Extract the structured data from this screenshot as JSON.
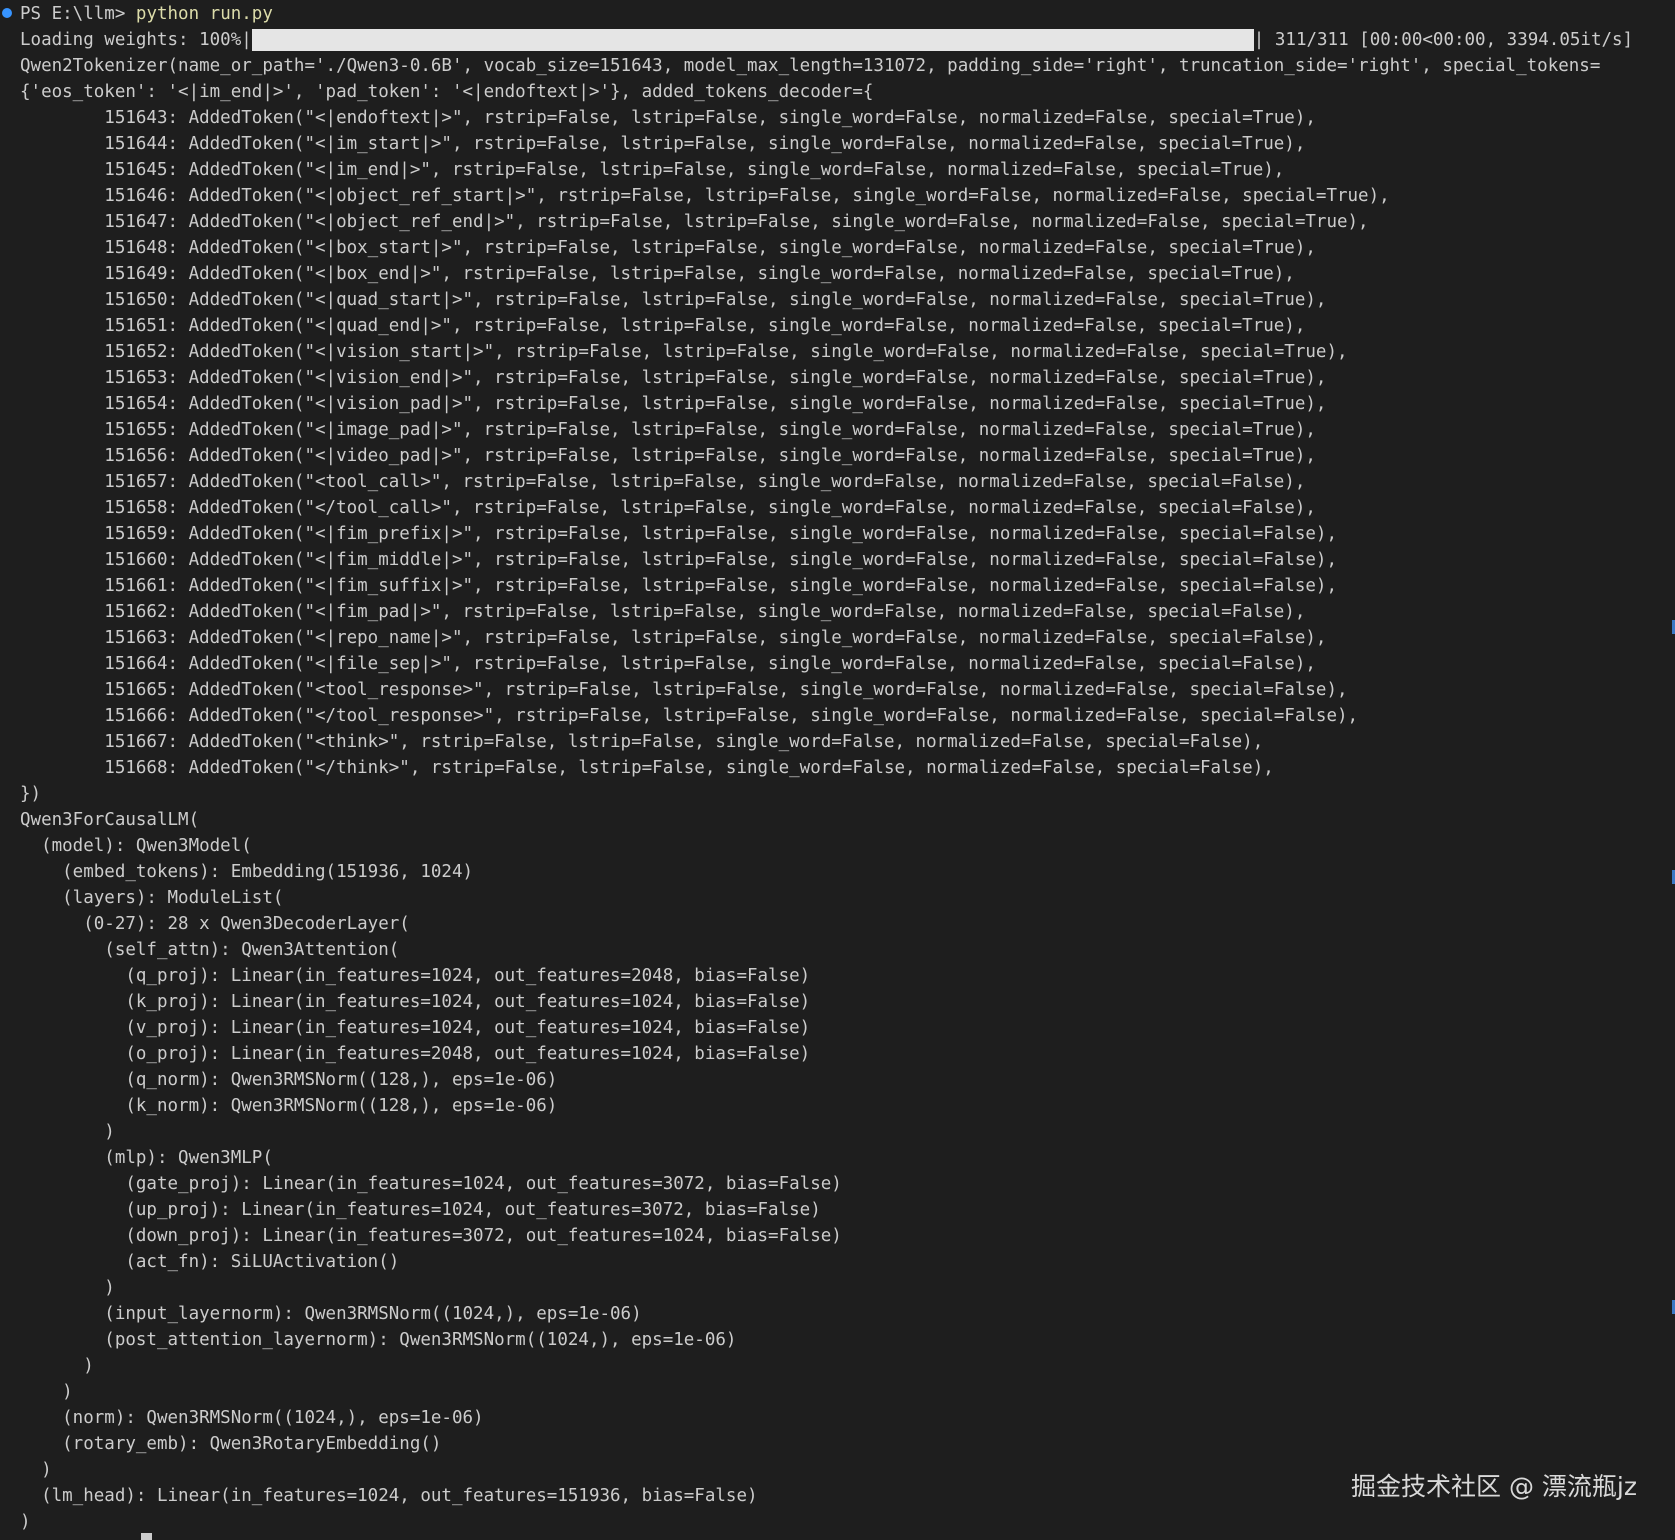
{
  "prompt": {
    "text": "PS E:\\llm> ",
    "command": "python run.py"
  },
  "progress": {
    "label": "Loading weights: 100%|",
    "fraction": 1.0,
    "suffix": "| 311/311 [00:00<00:00, 3394.05it/s]"
  },
  "lines": [
    "Qwen2Tokenizer(name_or_path='./Qwen3-0.6B', vocab_size=151643, model_max_length=131072, padding_side='right', truncation_side='right', special_tokens=",
    "{'eos_token': '<|im_end|>', 'pad_token': '<|endoftext|>'}, added_tokens_decoder={",
    "        151643: AddedToken(\"<|endoftext|>\", rstrip=False, lstrip=False, single_word=False, normalized=False, special=True),",
    "        151644: AddedToken(\"<|im_start|>\", rstrip=False, lstrip=False, single_word=False, normalized=False, special=True),",
    "        151645: AddedToken(\"<|im_end|>\", rstrip=False, lstrip=False, single_word=False, normalized=False, special=True),",
    "        151646: AddedToken(\"<|object_ref_start|>\", rstrip=False, lstrip=False, single_word=False, normalized=False, special=True),",
    "        151647: AddedToken(\"<|object_ref_end|>\", rstrip=False, lstrip=False, single_word=False, normalized=False, special=True),",
    "        151648: AddedToken(\"<|box_start|>\", rstrip=False, lstrip=False, single_word=False, normalized=False, special=True),",
    "        151649: AddedToken(\"<|box_end|>\", rstrip=False, lstrip=False, single_word=False, normalized=False, special=True),",
    "        151650: AddedToken(\"<|quad_start|>\", rstrip=False, lstrip=False, single_word=False, normalized=False, special=True),",
    "        151651: AddedToken(\"<|quad_end|>\", rstrip=False, lstrip=False, single_word=False, normalized=False, special=True),",
    "        151652: AddedToken(\"<|vision_start|>\", rstrip=False, lstrip=False, single_word=False, normalized=False, special=True),",
    "        151653: AddedToken(\"<|vision_end|>\", rstrip=False, lstrip=False, single_word=False, normalized=False, special=True),",
    "        151654: AddedToken(\"<|vision_pad|>\", rstrip=False, lstrip=False, single_word=False, normalized=False, special=True),",
    "        151655: AddedToken(\"<|image_pad|>\", rstrip=False, lstrip=False, single_word=False, normalized=False, special=True),",
    "        151656: AddedToken(\"<|video_pad|>\", rstrip=False, lstrip=False, single_word=False, normalized=False, special=True),",
    "        151657: AddedToken(\"<tool_call>\", rstrip=False, lstrip=False, single_word=False, normalized=False, special=False),",
    "        151658: AddedToken(\"</tool_call>\", rstrip=False, lstrip=False, single_word=False, normalized=False, special=False),",
    "        151659: AddedToken(\"<|fim_prefix|>\", rstrip=False, lstrip=False, single_word=False, normalized=False, special=False),",
    "        151660: AddedToken(\"<|fim_middle|>\", rstrip=False, lstrip=False, single_word=False, normalized=False, special=False),",
    "        151661: AddedToken(\"<|fim_suffix|>\", rstrip=False, lstrip=False, single_word=False, normalized=False, special=False),",
    "        151662: AddedToken(\"<|fim_pad|>\", rstrip=False, lstrip=False, single_word=False, normalized=False, special=False),",
    "        151663: AddedToken(\"<|repo_name|>\", rstrip=False, lstrip=False, single_word=False, normalized=False, special=False),",
    "        151664: AddedToken(\"<|file_sep|>\", rstrip=False, lstrip=False, single_word=False, normalized=False, special=False),",
    "        151665: AddedToken(\"<tool_response>\", rstrip=False, lstrip=False, single_word=False, normalized=False, special=False),",
    "        151666: AddedToken(\"</tool_response>\", rstrip=False, lstrip=False, single_word=False, normalized=False, special=False),",
    "        151667: AddedToken(\"<think>\", rstrip=False, lstrip=False, single_word=False, normalized=False, special=False),",
    "        151668: AddedToken(\"</think>\", rstrip=False, lstrip=False, single_word=False, normalized=False, special=False),",
    "})",
    "Qwen3ForCausalLM(",
    "  (model): Qwen3Model(",
    "    (embed_tokens): Embedding(151936, 1024)",
    "    (layers): ModuleList(",
    "      (0-27): 28 x Qwen3DecoderLayer(",
    "        (self_attn): Qwen3Attention(",
    "          (q_proj): Linear(in_features=1024, out_features=2048, bias=False)",
    "          (k_proj): Linear(in_features=1024, out_features=1024, bias=False)",
    "          (v_proj): Linear(in_features=1024, out_features=1024, bias=False)",
    "          (o_proj): Linear(in_features=2048, out_features=1024, bias=False)",
    "          (q_norm): Qwen3RMSNorm((128,), eps=1e-06)",
    "          (k_norm): Qwen3RMSNorm((128,), eps=1e-06)",
    "        )",
    "        (mlp): Qwen3MLP(",
    "          (gate_proj): Linear(in_features=1024, out_features=3072, bias=False)",
    "          (up_proj): Linear(in_features=1024, out_features=3072, bias=False)",
    "          (down_proj): Linear(in_features=3072, out_features=1024, bias=False)",
    "          (act_fn): SiLUActivation()",
    "        )",
    "        (input_layernorm): Qwen3RMSNorm((1024,), eps=1e-06)",
    "        (post_attention_layernorm): Qwen3RMSNorm((1024,), eps=1e-06)",
    "      )",
    "    )",
    "    (norm): Qwen3RMSNorm((1024,), eps=1e-06)",
    "    (rotary_emb): Qwen3RotaryEmbedding()",
    "  )",
    "  (lm_head): Linear(in_features=1024, out_features=151936, bias=False)",
    ")"
  ],
  "watermark": "掘金技术社区 @ 漂流瓶jz",
  "colors": {
    "background": "#1e1e1e",
    "foreground": "#cccccc",
    "command": "#dcdcaa",
    "prompt_dot": "#3794ff",
    "progress_fill": "#e5e5e5"
  }
}
